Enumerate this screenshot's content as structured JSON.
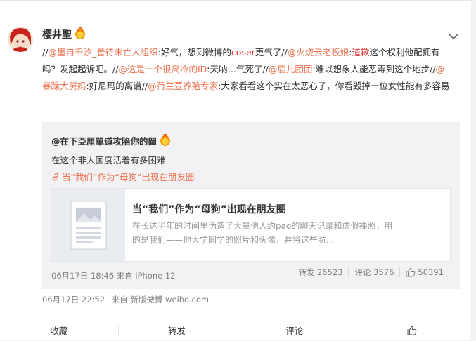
{
  "post": {
    "username": "樱井聖",
    "content_segments": [
      {
        "t": "//",
        "c": "sep"
      },
      {
        "t": "@墨冉千汐_善待末亡人组织",
        "c": "at"
      },
      {
        "t": ":好气，想到微博的",
        "c": "txt"
      },
      {
        "t": "coser",
        "c": "red"
      },
      {
        "t": "更气了//",
        "c": "txt"
      },
      {
        "t": "@火烧云老板娘",
        "c": "at"
      },
      {
        "t": ":",
        "c": "txt"
      },
      {
        "t": "道歉",
        "c": "red"
      },
      {
        "t": "这个权利他配拥有吗？发起起诉吧。//",
        "c": "txt"
      },
      {
        "t": "@这是一个很高冷的ID",
        "c": "at"
      },
      {
        "t": ":天呐…气死了//",
        "c": "txt"
      },
      {
        "t": "@鹿儿团团",
        "c": "at"
      },
      {
        "t": ":难以想象人能恶毒到这个地步//",
        "c": "txt"
      },
      {
        "t": "@暴躁大舅妈",
        "c": "at"
      },
      {
        "t": ":好尼玛的离谱//",
        "c": "txt"
      },
      {
        "t": "@荷兰豆养殖专家",
        "c": "at"
      },
      {
        "t": ":大家看看这个实在太恶心了，你看毁掉一位女性能有多容易",
        "c": "txt"
      }
    ],
    "meta": {
      "time": "06月17日 22:52",
      "source": "来自 新版微博 weibo.com"
    }
  },
  "quote": {
    "author": "@在下亞厘單道攻陷你的閫",
    "text": "在这个非人国度活着有多困难",
    "link_label": "当“我们”作为“母狗”出现在朋友圈",
    "article": {
      "title": "当“我们”作为“母狗”出现在朋友圈",
      "desc": "在长达半年的时间里伪造了大量他人约pao的聊天记录和虚假裸照，用的是我们——他大学同学的照片和头像，并将这些肮..."
    },
    "meta": "06月17日 18:46 来自 iPhone 12",
    "stats": {
      "repost": "转发 26523",
      "comment": "评论 3576",
      "like": "50391"
    }
  },
  "actions": {
    "favorite": "收藏",
    "repost": "转发",
    "comment": "评论"
  },
  "colors": {
    "link": "#eb7350",
    "red": "#e2312c",
    "muted": "#808080"
  },
  "icons": {
    "vip": "crown-badge-icon",
    "chevron": "chevron-down-icon",
    "link": "link-icon",
    "like": "thumbs-up-icon"
  }
}
